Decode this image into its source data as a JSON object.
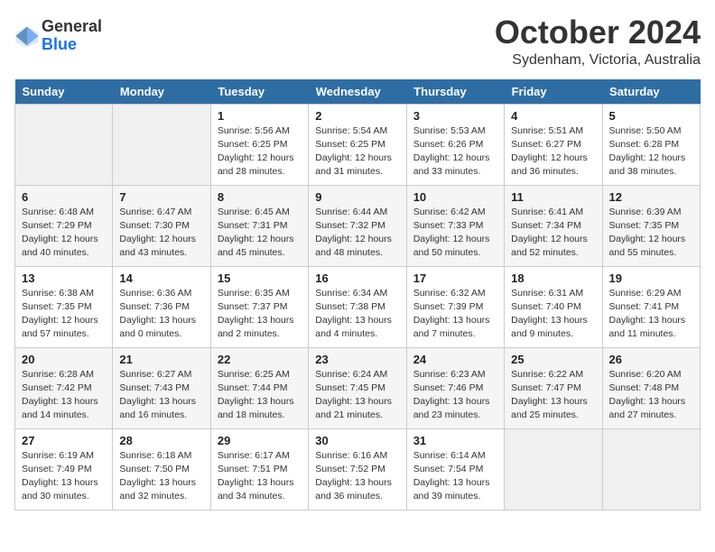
{
  "logo": {
    "general": "General",
    "blue": "Blue"
  },
  "title": "October 2024",
  "location": "Sydenham, Victoria, Australia",
  "weekdays": [
    "Sunday",
    "Monday",
    "Tuesday",
    "Wednesday",
    "Thursday",
    "Friday",
    "Saturday"
  ],
  "weeks": [
    [
      {
        "day": "",
        "info": ""
      },
      {
        "day": "",
        "info": ""
      },
      {
        "day": "1",
        "info": "Sunrise: 5:56 AM\nSunset: 6:25 PM\nDaylight: 12 hours and 28 minutes."
      },
      {
        "day": "2",
        "info": "Sunrise: 5:54 AM\nSunset: 6:25 PM\nDaylight: 12 hours and 31 minutes."
      },
      {
        "day": "3",
        "info": "Sunrise: 5:53 AM\nSunset: 6:26 PM\nDaylight: 12 hours and 33 minutes."
      },
      {
        "day": "4",
        "info": "Sunrise: 5:51 AM\nSunset: 6:27 PM\nDaylight: 12 hours and 36 minutes."
      },
      {
        "day": "5",
        "info": "Sunrise: 5:50 AM\nSunset: 6:28 PM\nDaylight: 12 hours and 38 minutes."
      }
    ],
    [
      {
        "day": "6",
        "info": "Sunrise: 6:48 AM\nSunset: 7:29 PM\nDaylight: 12 hours and 40 minutes."
      },
      {
        "day": "7",
        "info": "Sunrise: 6:47 AM\nSunset: 7:30 PM\nDaylight: 12 hours and 43 minutes."
      },
      {
        "day": "8",
        "info": "Sunrise: 6:45 AM\nSunset: 7:31 PM\nDaylight: 12 hours and 45 minutes."
      },
      {
        "day": "9",
        "info": "Sunrise: 6:44 AM\nSunset: 7:32 PM\nDaylight: 12 hours and 48 minutes."
      },
      {
        "day": "10",
        "info": "Sunrise: 6:42 AM\nSunset: 7:33 PM\nDaylight: 12 hours and 50 minutes."
      },
      {
        "day": "11",
        "info": "Sunrise: 6:41 AM\nSunset: 7:34 PM\nDaylight: 12 hours and 52 minutes."
      },
      {
        "day": "12",
        "info": "Sunrise: 6:39 AM\nSunset: 7:35 PM\nDaylight: 12 hours and 55 minutes."
      }
    ],
    [
      {
        "day": "13",
        "info": "Sunrise: 6:38 AM\nSunset: 7:35 PM\nDaylight: 12 hours and 57 minutes."
      },
      {
        "day": "14",
        "info": "Sunrise: 6:36 AM\nSunset: 7:36 PM\nDaylight: 13 hours and 0 minutes."
      },
      {
        "day": "15",
        "info": "Sunrise: 6:35 AM\nSunset: 7:37 PM\nDaylight: 13 hours and 2 minutes."
      },
      {
        "day": "16",
        "info": "Sunrise: 6:34 AM\nSunset: 7:38 PM\nDaylight: 13 hours and 4 minutes."
      },
      {
        "day": "17",
        "info": "Sunrise: 6:32 AM\nSunset: 7:39 PM\nDaylight: 13 hours and 7 minutes."
      },
      {
        "day": "18",
        "info": "Sunrise: 6:31 AM\nSunset: 7:40 PM\nDaylight: 13 hours and 9 minutes."
      },
      {
        "day": "19",
        "info": "Sunrise: 6:29 AM\nSunset: 7:41 PM\nDaylight: 13 hours and 11 minutes."
      }
    ],
    [
      {
        "day": "20",
        "info": "Sunrise: 6:28 AM\nSunset: 7:42 PM\nDaylight: 13 hours and 14 minutes."
      },
      {
        "day": "21",
        "info": "Sunrise: 6:27 AM\nSunset: 7:43 PM\nDaylight: 13 hours and 16 minutes."
      },
      {
        "day": "22",
        "info": "Sunrise: 6:25 AM\nSunset: 7:44 PM\nDaylight: 13 hours and 18 minutes."
      },
      {
        "day": "23",
        "info": "Sunrise: 6:24 AM\nSunset: 7:45 PM\nDaylight: 13 hours and 21 minutes."
      },
      {
        "day": "24",
        "info": "Sunrise: 6:23 AM\nSunset: 7:46 PM\nDaylight: 13 hours and 23 minutes."
      },
      {
        "day": "25",
        "info": "Sunrise: 6:22 AM\nSunset: 7:47 PM\nDaylight: 13 hours and 25 minutes."
      },
      {
        "day": "26",
        "info": "Sunrise: 6:20 AM\nSunset: 7:48 PM\nDaylight: 13 hours and 27 minutes."
      }
    ],
    [
      {
        "day": "27",
        "info": "Sunrise: 6:19 AM\nSunset: 7:49 PM\nDaylight: 13 hours and 30 minutes."
      },
      {
        "day": "28",
        "info": "Sunrise: 6:18 AM\nSunset: 7:50 PM\nDaylight: 13 hours and 32 minutes."
      },
      {
        "day": "29",
        "info": "Sunrise: 6:17 AM\nSunset: 7:51 PM\nDaylight: 13 hours and 34 minutes."
      },
      {
        "day": "30",
        "info": "Sunrise: 6:16 AM\nSunset: 7:52 PM\nDaylight: 13 hours and 36 minutes."
      },
      {
        "day": "31",
        "info": "Sunrise: 6:14 AM\nSunset: 7:54 PM\nDaylight: 13 hours and 39 minutes."
      },
      {
        "day": "",
        "info": ""
      },
      {
        "day": "",
        "info": ""
      }
    ]
  ]
}
